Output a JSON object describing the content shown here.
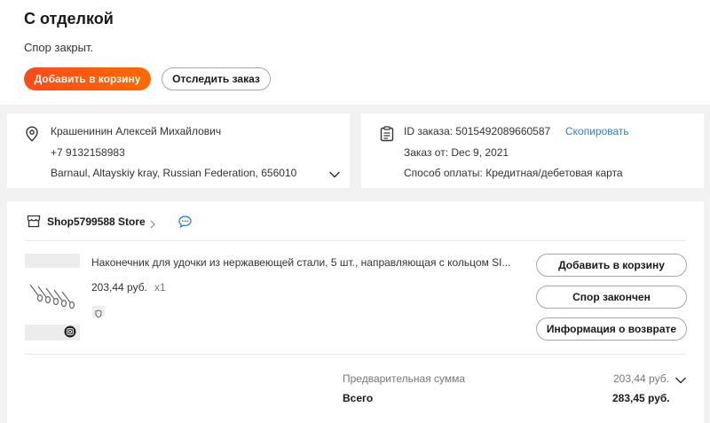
{
  "header": {
    "title": "С отделкой",
    "status": "Спор закрыт.",
    "add_to_cart": "Добавить в корзину",
    "track_order": "Отследить заказ"
  },
  "address": {
    "name": "Крашенинин Алексей Михайлович",
    "phone": "+7 9132158983",
    "location": "Barnaul, Altayskiy kray, Russian Federation, 656010"
  },
  "order": {
    "id_label": "ID заказа: 5015492089660587",
    "copy_label": "Скопировать",
    "date_label": "Заказ от: Dec 9, 2021",
    "payment_label": "Способ оплаты: Кредитная/дебетовая карта"
  },
  "shop": {
    "name": "Shop5799588 Store"
  },
  "product": {
    "name": "Наконечник для удочки из нержавеющей стали, 5 шт., направляющая с кольцом SI...",
    "price": "203,44 руб.",
    "qty": "x1",
    "actions": {
      "add_to_cart": "Добавить в корзину",
      "dispute_closed": "Спор закончен",
      "return_info": "Информация о возврате"
    }
  },
  "summary": {
    "subtotal_label": "Предварительная сумма",
    "subtotal_value": "203,44 руб.",
    "total_label": "Всего",
    "total_value": "283,45 руб."
  },
  "colors": {
    "accent": "#ff4a1a",
    "link": "#2e7bd6",
    "chat": "#2e7bd6"
  },
  "icons": [
    "location-pin-icon",
    "chevron-down-icon",
    "clipboard-icon",
    "store-icon",
    "chevron-right-icon",
    "chat-icon",
    "camera-icon",
    "shield-icon"
  ]
}
